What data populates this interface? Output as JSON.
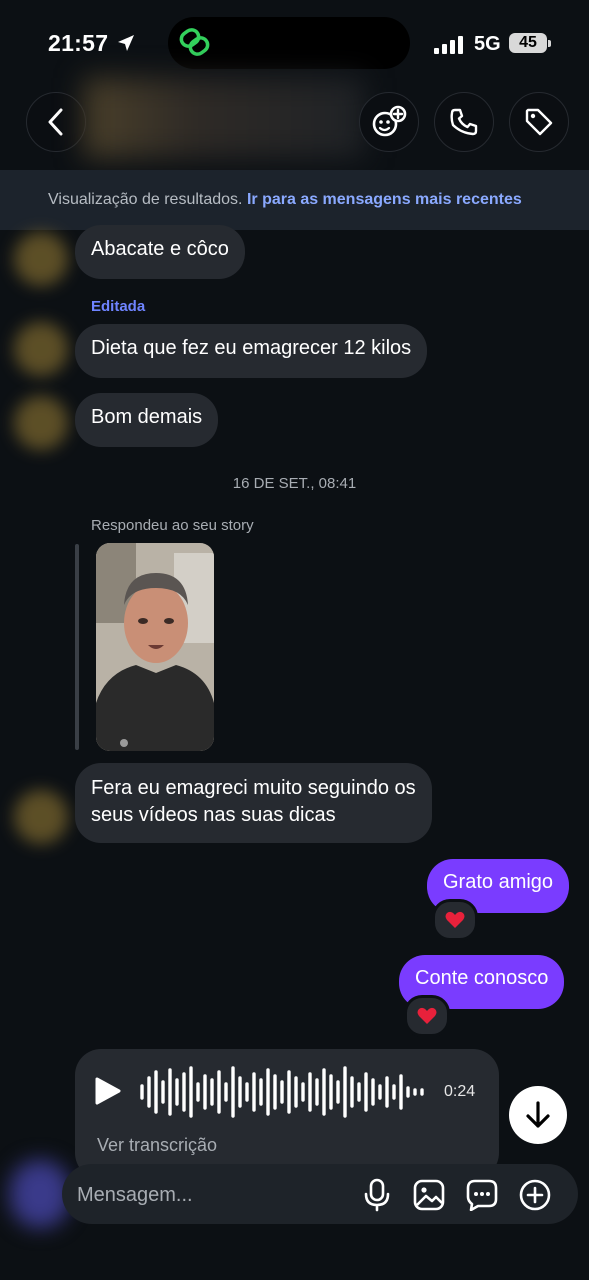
{
  "status_bar": {
    "time": "21:57",
    "network": "5G",
    "battery": "45"
  },
  "header": {
    "back_icon": "chevron-left-icon",
    "actions": [
      "add-people-icon",
      "phone-icon",
      "tag-icon"
    ]
  },
  "banner": {
    "text": "Visualização de resultados.",
    "link": "Ir para as mensagens mais recentes"
  },
  "messages": {
    "m1": "Abacate e côco",
    "edited_label": "Editada",
    "m2": "Dieta que fez eu emagrecer 12 kilos",
    "m3": "Bom demais",
    "timestamp": "16 DE SET., 08:41",
    "story_reply_label": "Respondeu ao seu story",
    "m4_line1": "Fera eu emagreci muito seguindo os",
    "m4_line2": "seus vídeos nas suas dicas",
    "out1": "Grato amigo",
    "out2": "Conte conosco",
    "reaction": "❤️"
  },
  "audio": {
    "duration": "0:24",
    "transcript_link": "Ver transcrição"
  },
  "composer": {
    "placeholder": "Mensagem..."
  },
  "colors": {
    "background": "#0c1014",
    "incoming_bubble": "#262a30",
    "outgoing_bubble": "#7a3cff",
    "link": "#8aa9ff"
  }
}
